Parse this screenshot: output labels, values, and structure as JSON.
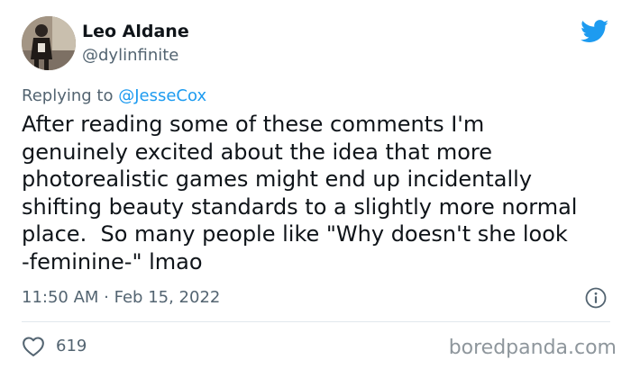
{
  "author": {
    "display_name": "Leo Aldane",
    "handle": "@dylinfinite"
  },
  "reply": {
    "prefix": "Replying to ",
    "mention": "@JesseCox"
  },
  "body": {
    "lines": [
      "After reading some of these comments I'm",
      "genuinely excited about the idea that more",
      "photorealistic games might end up incidentally",
      "shifting beauty standards to a slightly more normal",
      "place.  So many people like \"Why doesn't she look",
      "-feminine-\" lmao"
    ]
  },
  "meta": {
    "timestamp": "11:50 AM · Feb 15, 2022"
  },
  "actions": {
    "like_count": "619"
  },
  "watermark": "boredpanda.com",
  "colors": {
    "twitter_blue": "#1d9bf0",
    "text": "#0f1419",
    "muted": "#536471"
  },
  "icons": {
    "brand": "twitter-bird-icon",
    "info": "info-icon",
    "like": "heart-icon"
  }
}
